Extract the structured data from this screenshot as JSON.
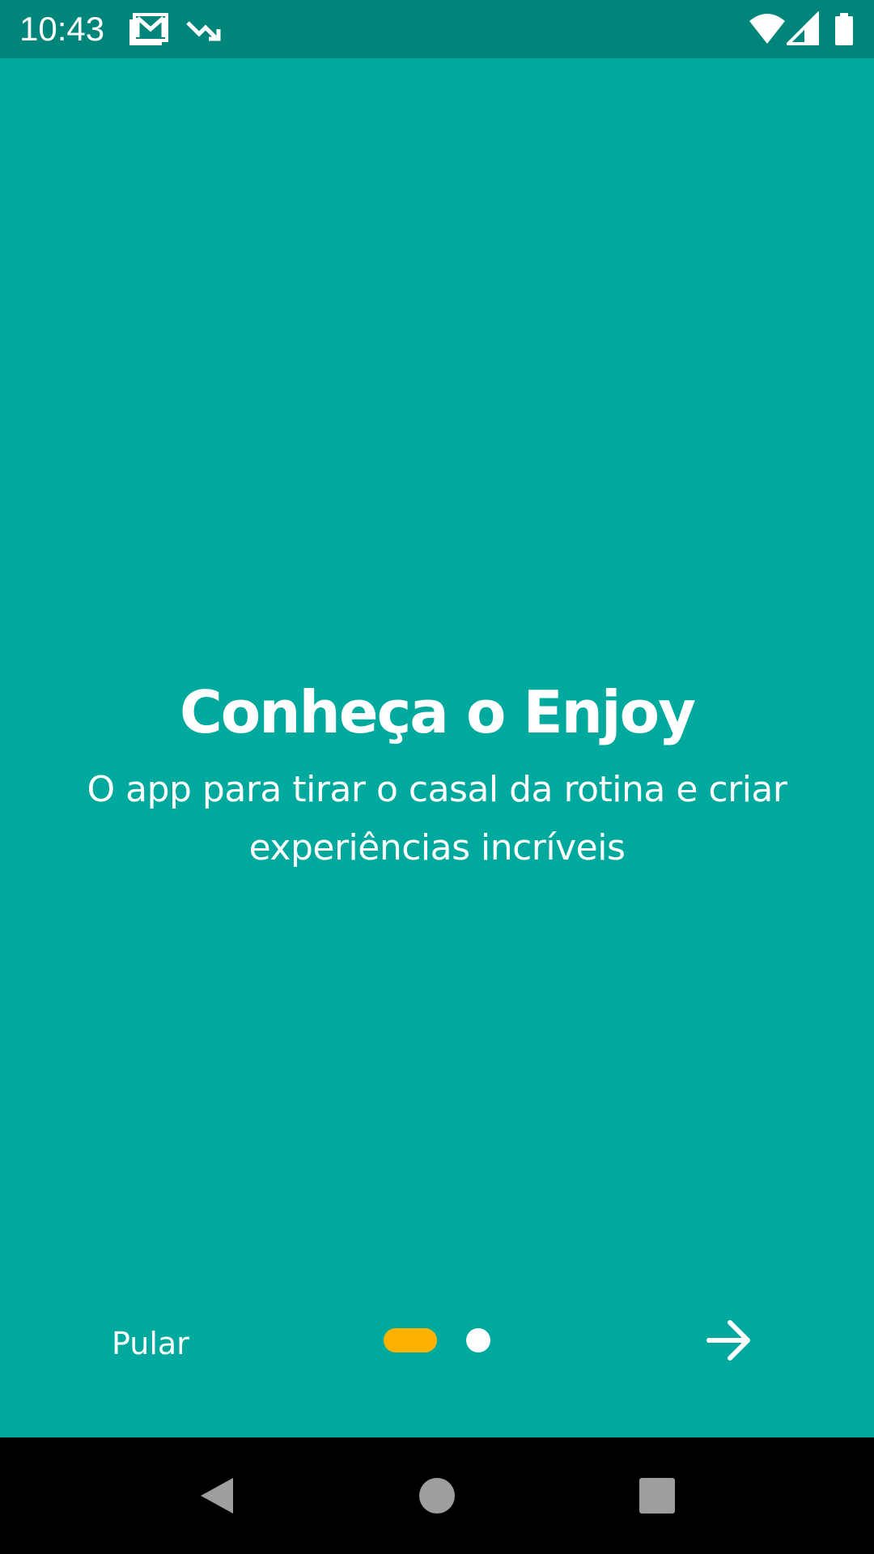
{
  "status_bar": {
    "time": "10:43",
    "background": "#00857A",
    "icons_left": [
      "gmail-icon",
      "trending-down-icon"
    ],
    "icons_right": [
      "wifi-icon",
      "cell-signal-icon",
      "battery-icon"
    ]
  },
  "colors": {
    "background": "#00A99D",
    "text": "#FFFFFF",
    "indicator_active": "#FFB300",
    "indicator_inactive": "#FFFFFF",
    "nav_bar": "#000000",
    "nav_buttons": "#9E9E9E"
  },
  "onboarding": {
    "title": "Conheça o Enjoy",
    "subtitle": "O app para tirar o casal da rotina e criar experiências incríveis",
    "skip_label": "Pular",
    "page_indicator": {
      "total": 2,
      "current": 1
    },
    "next_icon": "arrow-right-icon"
  },
  "nav_bar": {
    "buttons": [
      "back-icon",
      "home-icon",
      "recents-icon"
    ]
  }
}
